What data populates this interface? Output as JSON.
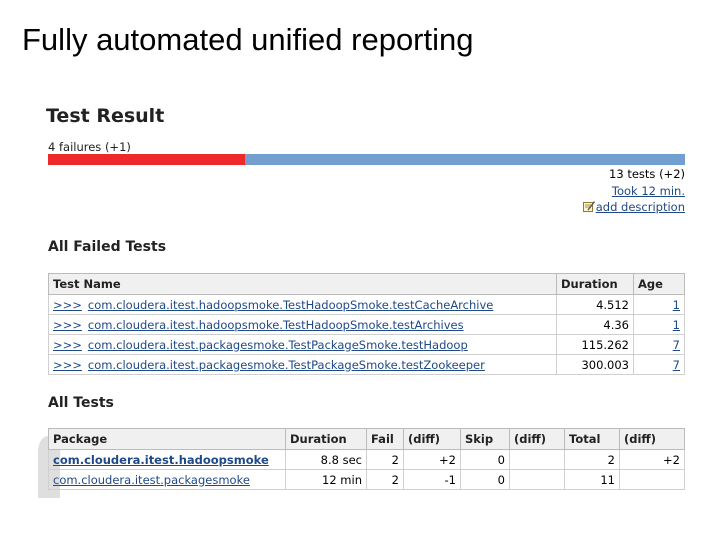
{
  "slide": {
    "title": "Fully automated unified reporting"
  },
  "colors": {
    "fail": "#ef2929",
    "pass": "#729fcf",
    "link": "#204a87"
  },
  "test_result": {
    "heading": "Test Result",
    "failures": "4 failures (+1)",
    "fail_fraction": 0.31,
    "tests_total": "13 tests (+2)",
    "took": "Took 12 min.",
    "add_description": "add description",
    "edit_icon": "edit-note-icon"
  },
  "failed_tests": {
    "heading": "All Failed Tests",
    "columns": [
      "Test Name",
      "Duration",
      "Age"
    ],
    "rows": [
      {
        "arrow": ">>>",
        "name": "com.cloudera.itest.hadoopsmoke.TestHadoopSmoke.testCacheArchive",
        "duration": "4.512",
        "age": "1"
      },
      {
        "arrow": ">>>",
        "name": "com.cloudera.itest.hadoopsmoke.TestHadoopSmoke.testArchives",
        "duration": "4.36",
        "age": "1"
      },
      {
        "arrow": ">>>",
        "name": "com.cloudera.itest.packagesmoke.TestPackageSmoke.testHadoop",
        "duration": "115.262",
        "age": "7"
      },
      {
        "arrow": ">>>",
        "name": "com.cloudera.itest.packagesmoke.TestPackageSmoke.testZookeeper",
        "duration": "300.003",
        "age": "7"
      }
    ]
  },
  "all_tests": {
    "heading": "All Tests",
    "columns": [
      "Package",
      "Duration",
      "Fail",
      "(diff)",
      "Skip",
      "(diff)",
      "Total",
      "(diff)"
    ],
    "rows": [
      {
        "package": "com.cloudera.itest.hadoopsmoke",
        "duration": "8.8 sec",
        "fail": "2",
        "fail_diff": "+2",
        "skip": "0",
        "skip_diff": "",
        "total": "2",
        "total_diff": "+2"
      },
      {
        "package": "com.cloudera.itest.packagesmoke",
        "duration": "12 min",
        "fail": "2",
        "fail_diff": "-1",
        "skip": "0",
        "skip_diff": "",
        "total": "11",
        "total_diff": ""
      }
    ]
  }
}
